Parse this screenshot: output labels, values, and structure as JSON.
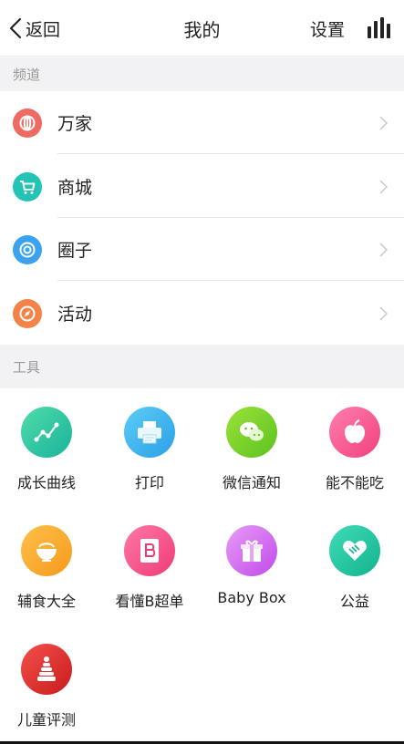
{
  "nav": {
    "back_label": "返回",
    "title": "我的",
    "settings_label": "设置"
  },
  "sections": {
    "channels_header": "频道",
    "tools_header": "工具"
  },
  "channels": [
    {
      "label": "万家",
      "icon": "wanjia-icon",
      "color": "#ef6b62"
    },
    {
      "label": "商城",
      "icon": "cart-icon",
      "color": "#23c4b5"
    },
    {
      "label": "圈子",
      "icon": "target-icon",
      "color": "#3aa2ef"
    },
    {
      "label": "活动",
      "icon": "compass-icon",
      "color": "#f2844a"
    }
  ],
  "tools": [
    {
      "label": "成长曲线",
      "icon": "growth-curve-icon",
      "colors": [
        "#4fdcaa",
        "#19b39a"
      ]
    },
    {
      "label": "打印",
      "icon": "printer-icon",
      "colors": [
        "#5dcdf6",
        "#2b9fe6"
      ]
    },
    {
      "label": "微信通知",
      "icon": "wechat-icon",
      "colors": [
        "#9be23a",
        "#5cc21f"
      ]
    },
    {
      "label": "能不能吃",
      "icon": "apple-icon",
      "colors": [
        "#ff7fb0",
        "#f2407d"
      ]
    },
    {
      "label": "辅食大全",
      "icon": "bowl-icon",
      "colors": [
        "#ffc04a",
        "#f59a1c"
      ]
    },
    {
      "label": "看懂B超单",
      "icon": "ultrasound-report-icon",
      "colors": [
        "#ff78a6",
        "#ee3b78"
      ]
    },
    {
      "label": "Baby Box",
      "icon": "gift-box-icon",
      "colors": [
        "#e99af8",
        "#c04be8"
      ]
    },
    {
      "label": "公益",
      "icon": "heart-hands-icon",
      "colors": [
        "#3fdcb6",
        "#12b38f"
      ]
    },
    {
      "label": "儿童评测",
      "icon": "stacking-rings-icon",
      "colors": [
        "#f5504c",
        "#c71c1c"
      ]
    }
  ]
}
